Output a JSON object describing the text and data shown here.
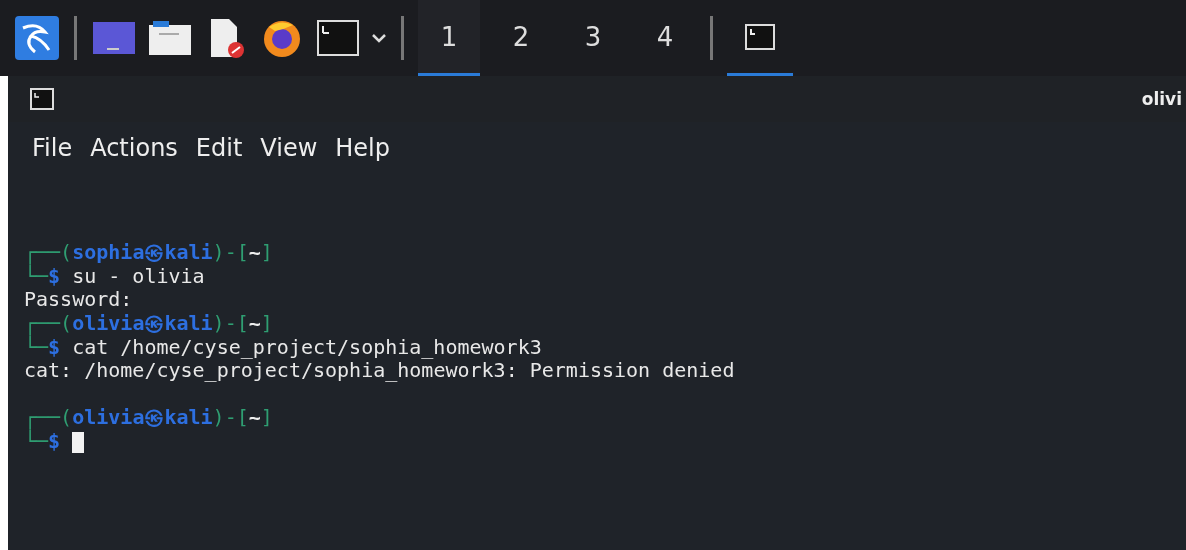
{
  "taskbar": {
    "launchers": [
      {
        "kind": "menu"
      },
      {
        "kind": "desktop"
      },
      {
        "kind": "files"
      },
      {
        "kind": "editor"
      },
      {
        "kind": "browser"
      },
      {
        "kind": "terminal"
      }
    ],
    "workspaces": [
      {
        "label": "1",
        "selected": true
      },
      {
        "label": "2",
        "selected": false
      },
      {
        "label": "3",
        "selected": false
      },
      {
        "label": "4",
        "selected": false
      }
    ],
    "tasks": [
      {
        "kind": "terminal",
        "selected": true
      }
    ]
  },
  "window": {
    "title": "olivi"
  },
  "menu": [
    "File",
    "Actions",
    "Edit",
    "View",
    "Help"
  ],
  "terminal": {
    "lines": [
      {
        "kind": "prompt",
        "parts": [
          "┌──(",
          "sophia㉿kali",
          ")-[",
          "~",
          "]"
        ]
      },
      {
        "kind": "command",
        "parts": [
          "└─",
          "$",
          "su - olivia"
        ]
      },
      {
        "kind": "output",
        "parts": [
          "Password:"
        ]
      },
      {
        "kind": "prompt",
        "parts": [
          "┌──(",
          "olivia㉿kali",
          ")-[",
          "~",
          "]"
        ]
      },
      {
        "kind": "command",
        "parts": [
          "└─",
          "$",
          "cat /home/cyse_project/sophia_homework3"
        ]
      },
      {
        "kind": "output",
        "parts": [
          "cat: /home/cyse_project/sophia_homework3: Permission denied"
        ]
      },
      {
        "kind": "blank"
      },
      {
        "kind": "prompt",
        "parts": [
          "┌──(",
          "olivia㉿kali",
          ")-[",
          "~",
          "]"
        ]
      },
      {
        "kind": "input",
        "parts": [
          "└─",
          "$"
        ]
      }
    ]
  }
}
